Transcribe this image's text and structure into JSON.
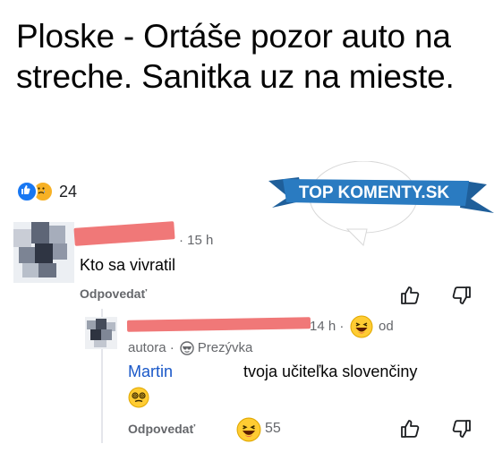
{
  "post": {
    "text": "Ploske - Ortáše pozor auto na streche. Sanitka uz na mieste.",
    "reaction_count": "24"
  },
  "logo": {
    "text": "TOP KOMENTY.SK"
  },
  "comments": [
    {
      "time": "· 15 h",
      "text": "Kto sa vivratil",
      "reply_label": "Odpovedať"
    },
    {
      "time": "14 h ·",
      "od_label": "od",
      "author_tag": "autora ·",
      "nickname_label": "Prezývka",
      "mention": "Martin",
      "text": "tvoja učiteľka slovenčiny",
      "reply_label": "Odpovedať",
      "reaction_count": "55"
    }
  ],
  "colors": {
    "like_blue": "#1877f2",
    "emoji_yellow": "#f7b125",
    "redaction": "#f07878",
    "mention_blue": "#1a58c8",
    "logo_blue": "#2a7bc1"
  }
}
